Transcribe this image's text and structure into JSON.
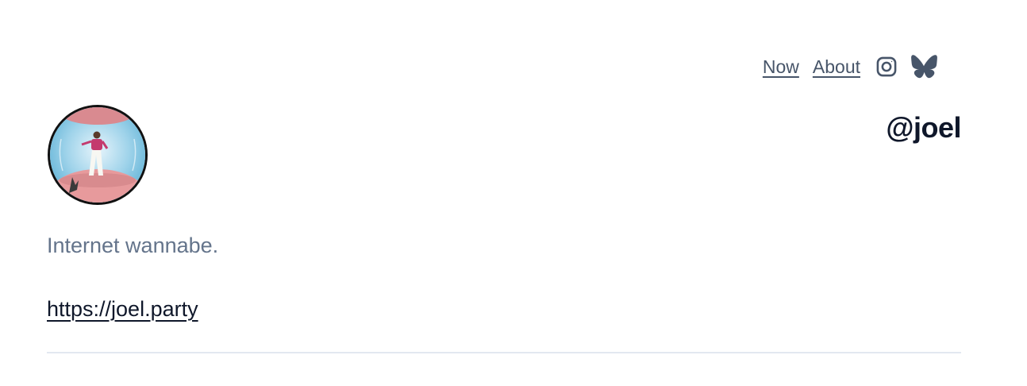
{
  "nav": {
    "links": [
      {
        "label": "Now"
      },
      {
        "label": "About"
      }
    ],
    "icons": [
      "instagram-icon",
      "bluesky-butterfly-icon"
    ]
  },
  "profile": {
    "handle": "@joel",
    "bio": "Internet wannabe.",
    "website": "https://joel.party",
    "avatar_icon": "avatar-photo"
  },
  "colors": {
    "nav_text": "#475569",
    "heading": "#0f172a",
    "muted": "#64748b",
    "divider": "#e2e8f0"
  }
}
